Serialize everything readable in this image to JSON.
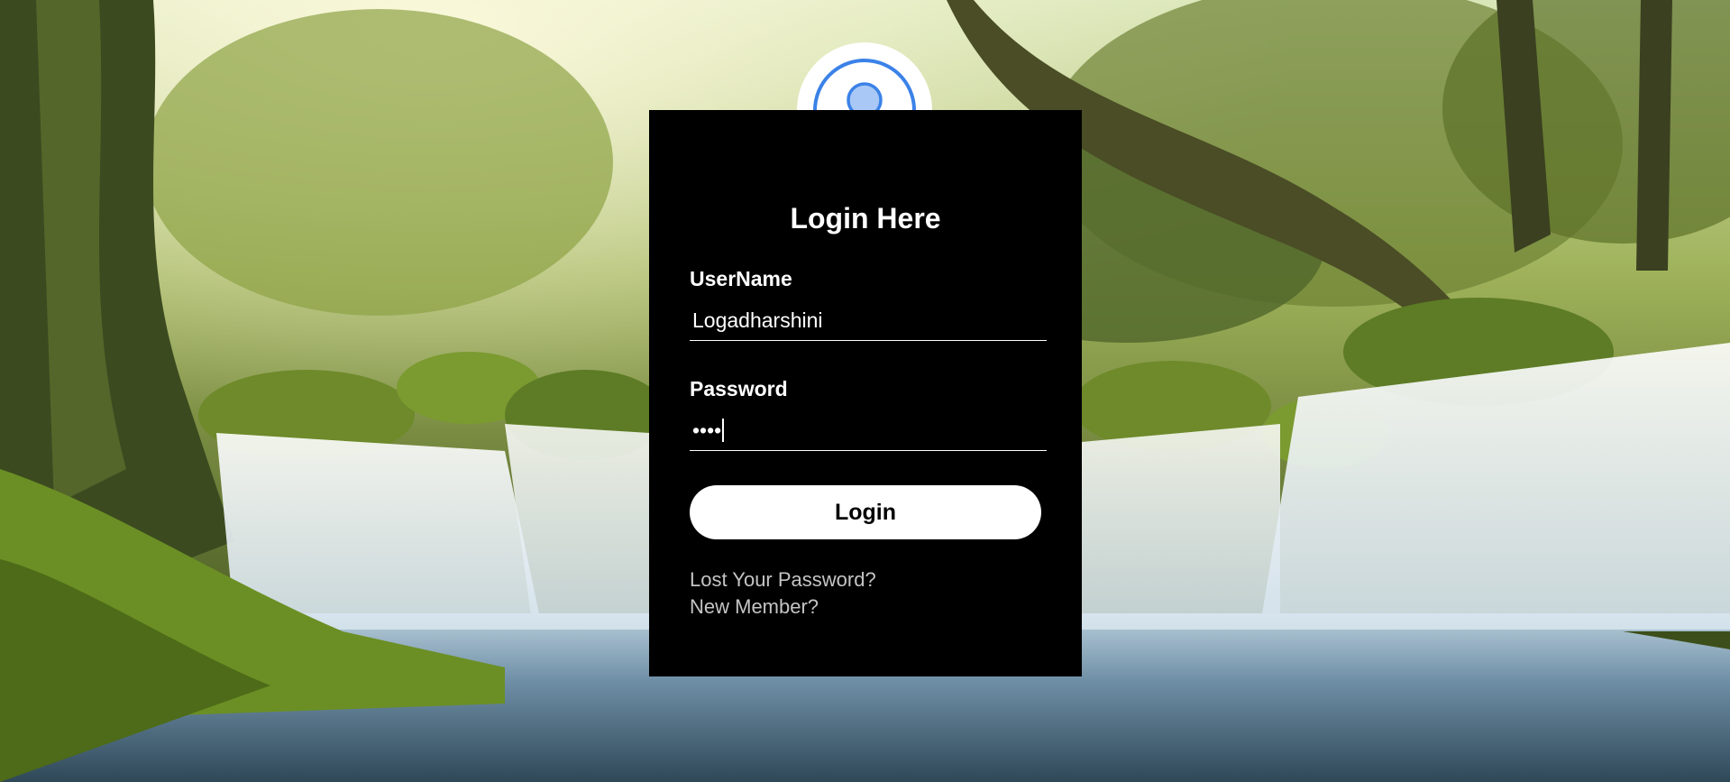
{
  "login": {
    "title": "Login Here",
    "username_label": "UserName",
    "username_value": "Logadharshini",
    "password_label": "Password",
    "password_value": "••••",
    "login_button": "Login",
    "lost_password_link": "Lost Your Password?",
    "new_member_link": "New Member?"
  },
  "icons": {
    "avatar": "user-icon"
  },
  "colors": {
    "panel": "#000000",
    "avatar_ring": "#3b82e8",
    "link": "#c4c4c4",
    "water": "#dce9f3"
  }
}
